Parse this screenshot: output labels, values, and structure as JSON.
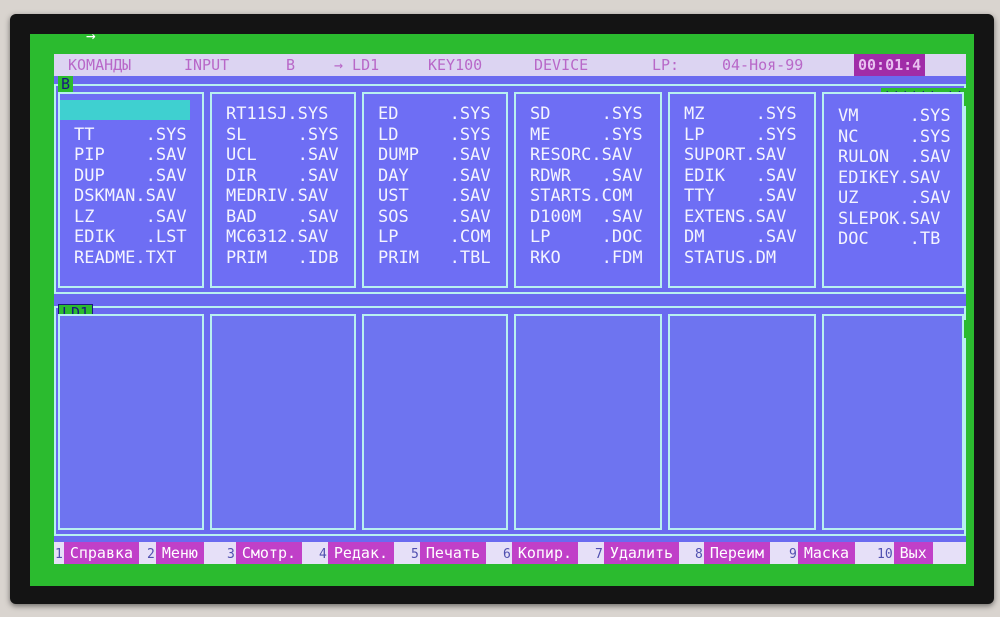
{
  "topbar": {
    "menu_commands": "КОМАНДЫ",
    "menu_input": "INPUT",
    "drive": "B",
    "device_current": "→ LD1",
    "key": "KEY100",
    "menu_device": "DEVICE",
    "lp": "LP:",
    "date": "04-Ноя-99",
    "time": "00:01:4"
  },
  "top_panel": {
    "tag": "B",
    "stars": "******.**",
    "columns": [
      [
        "",
        "TT     .SYS",
        "PIP    .SAV",
        "DUP    .SAV",
        "DSKMAN.SAV",
        "LZ     .SAV",
        "EDIK   .LST",
        "README.TXT"
      ],
      [
        "RT11SJ.SYS",
        "SL     .SYS",
        "UCL    .SAV",
        "DIR    .SAV",
        "MEDRIV.SAV",
        "BAD    .SAV",
        "MC6312.SAV",
        "PRIM   .IDB"
      ],
      [
        "ED     .SYS",
        "LD     .SYS",
        "DUMP   .SAV",
        "DAY    .SAV",
        "UST    .SAV",
        "SOS    .SAV",
        "LP     .COM",
        "PRIM   .TBL"
      ],
      [
        "SD     .SYS",
        "ME     .SYS",
        "RESORC.SAV",
        "RDWR   .SAV",
        "STARTS.COM",
        "D100M  .SAV",
        "LP     .DOC",
        "RKO    .FDM"
      ],
      [
        "MZ     .SYS",
        "LP     .SYS",
        "SUPORT.SAV",
        "EDIK   .SAV",
        "TTY    .SAV",
        "EXTENS.SAV",
        "DM     .SAV",
        "STATUS.DM"
      ],
      [
        "VM     .SYS",
        "NC     .SYS",
        "RULON  .SAV",
        "EDIKEY.SAV",
        "UZ     .SAV",
        "SLEPOK.SAV",
        "DOC    .TB"
      ]
    ]
  },
  "bottom_panel": {
    "tag": "LD1",
    "stars": "******.**"
  },
  "fkeys": [
    {
      "num": "1",
      "label": "Справка"
    },
    {
      "num": "2",
      "label": "Меню"
    },
    {
      "num": "3",
      "label": "Смотр."
    },
    {
      "num": "4",
      "label": "Редак."
    },
    {
      "num": "5",
      "label": "Печать"
    },
    {
      "num": "6",
      "label": "Копир."
    },
    {
      "num": "7",
      "label": "Удалить"
    },
    {
      "num": "8",
      "label": "Переим"
    },
    {
      "num": "9",
      "label": "Маска"
    },
    {
      "num": "10",
      "label": "Вых"
    }
  ],
  "icons": [
    "cursor-arrow-icon"
  ],
  "colors": {
    "screen_green": "#2bbb2f",
    "panel_blue": "#6a6af0",
    "fkey_magenta": "#c040c8"
  }
}
